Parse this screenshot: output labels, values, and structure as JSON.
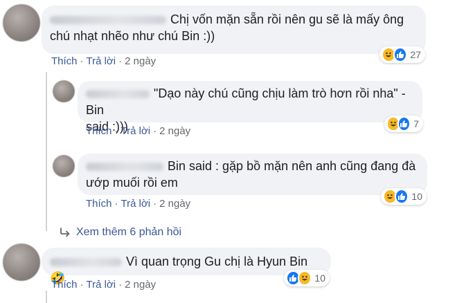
{
  "comments": [
    {
      "text": "Chị vốn mặn sẵn rồi nên gu sẽ là mấy ông chú nhạt nhẽo như chú Bin :))",
      "line1": "Chị vốn mặn sẵn rồi nên gu sẽ là mấy ông",
      "line2": "chú nhạt nhẽo như chú Bin :))",
      "like_label": "Thích",
      "reply_label": "Trả lời",
      "time": "2 ngày",
      "reaction_count": "27"
    },
    {
      "line1": "\"Dạo này chú cũng chịu làm trò hơn rồi nha\" - Bin",
      "line2": "said :)))",
      "like_label": "Thích",
      "reply_label": "Trả lời",
      "time": "2 ngày",
      "reaction_count": "7"
    },
    {
      "line1": "Bin said : gặp bồ mặn nên anh cũng đang đà",
      "line2": "ướp muối rồi em",
      "like_label": "Thích",
      "reply_label": "Trả lời",
      "time": "2 ngày",
      "reaction_count": "10"
    },
    {
      "line1": "Vì quan trọng Gu chị là Hyun Bin 🤣",
      "like_label": "Thích",
      "reply_label": "Trả lời",
      "time": "2 ngày",
      "reaction_count": "10"
    }
  ],
  "more_replies_label": "Xem thêm 6 phản hồi",
  "separator": "·",
  "colors": {
    "link": "#385898",
    "meta": "#65676b",
    "bubble": "#f0f2f5",
    "haha": "#f7b928",
    "like": "#1877f2"
  }
}
